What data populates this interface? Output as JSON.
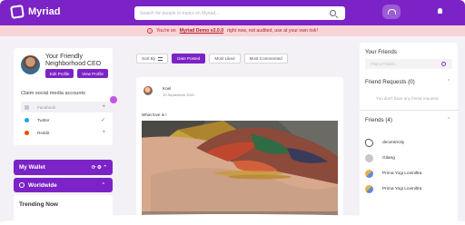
{
  "app": {
    "name": "Myriad"
  },
  "search": {
    "placeholder": "Search for people or topics on Myriad..."
  },
  "banner": {
    "prefix": "You're on",
    "link": "Myriad Demo v2.0.0",
    "suffix": "right now, not audited, use at your own risk!"
  },
  "profile": {
    "name": "Your Friendly Neighborhood CEO",
    "edit_label": "Edit Profile",
    "view_label": "View Profile"
  },
  "claim": {
    "title": "Claim social media accounts",
    "accounts": [
      {
        "label": "Facebook",
        "action": "+"
      },
      {
        "label": "Twitter",
        "action": "✓"
      },
      {
        "label": "Reddit",
        "action": "+"
      }
    ]
  },
  "wallet": {
    "label": "My Wallet",
    "tools": "⟳ ⚙ ⌃"
  },
  "worldwide": {
    "label": "Worldwide",
    "chevron": "⌃"
  },
  "trending": {
    "label": "Trending Now"
  },
  "sort": {
    "sort_label": "Sort By",
    "options": [
      "Date Posted",
      "Most Liked",
      "Most Commented"
    ],
    "active": "Date Posted"
  },
  "post": {
    "user": "Koel",
    "date": "10 September 2021",
    "text": "What love is !"
  },
  "friends_panel": {
    "title": "Your Friends",
    "find_placeholder": "Find a Friend...",
    "requests_title": "Friend Requests (0)",
    "no_requests": "You don't have any friend requests",
    "friends_title": "Friends (4)",
    "caret": "⌃",
    "friends": [
      {
        "name": "decentricity"
      },
      {
        "name": "Gilang"
      },
      {
        "name": "Prima Yogi Loviniltra"
      },
      {
        "name": "Prima Yogi Loviniltra"
      }
    ]
  },
  "colors": {
    "brand": "#7b23c6",
    "banner_bg": "#f8d4d8",
    "banner_text": "#b0202a"
  }
}
